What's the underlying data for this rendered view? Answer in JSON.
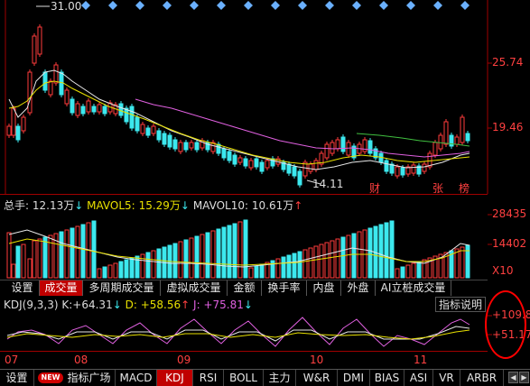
{
  "price_chart": {
    "high_marker": "31.00",
    "low_marker": "14.11",
    "price_levels": [
      "25.74",
      "19.46"
    ],
    "event_marks": [
      "财",
      "张",
      "榜"
    ]
  },
  "volume_panel": {
    "label_total": "总手:",
    "total_value": "12.13万",
    "mavol5_label": "MAVOL5:",
    "mavol5_value": "15.29万",
    "mavol10_label": "MAVOL10:",
    "mavol10_value": "10.61万",
    "scale_labels": [
      "28435",
      "14402",
      "X10"
    ]
  },
  "indicator_tabs": [
    {
      "label": "设置"
    },
    {
      "label": "成交量"
    },
    {
      "label": "多周期成交量"
    },
    {
      "label": "虚拟成交量"
    },
    {
      "label": "金额"
    },
    {
      "label": "换手率"
    },
    {
      "label": "内盘"
    },
    {
      "label": "外盘"
    },
    {
      "label": "AI立桩成交量"
    }
  ],
  "kdj_panel": {
    "title": "KDJ(9,3,3)",
    "k_label": "K:",
    "k_value": "+64.31",
    "d_label": "D:",
    "d_value": "+58.56",
    "j_label": "J:",
    "j_value": "+75.81",
    "help_button": "指标说明",
    "scale_labels": [
      "+109.8",
      "+51.17"
    ]
  },
  "time_axis": [
    "07",
    "08",
    "09",
    "10",
    "11"
  ],
  "bottom_tabs": {
    "settings": "设置",
    "new_badge": "NEW",
    "items": [
      "指标广场",
      "MACD",
      "KDJ",
      "RSI",
      "BOLL",
      "主力",
      "W&R",
      "DMI",
      "BIAS",
      "ASI",
      "VR",
      "ARBR"
    ]
  },
  "colors": {
    "up": "#ff3b3b",
    "down": "#3ce8ee",
    "ma_white": "#e8e8e8",
    "ma_yellow": "#e8e000",
    "ma_magenta": "#e060e0",
    "ma_green": "#40c040",
    "tab_active": "#c00000",
    "highlight_circle": "#ff0000"
  }
}
